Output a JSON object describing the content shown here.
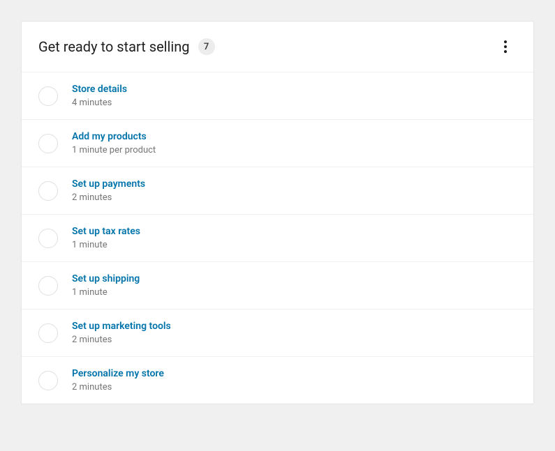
{
  "header": {
    "title": "Get ready to start selling",
    "badge_count": "7"
  },
  "tasks": [
    {
      "title": "Store details",
      "time": "4 minutes"
    },
    {
      "title": "Add my products",
      "time": "1 minute per product"
    },
    {
      "title": "Set up payments",
      "time": "2 minutes"
    },
    {
      "title": "Set up tax rates",
      "time": "1 minute"
    },
    {
      "title": "Set up shipping",
      "time": "1 minute"
    },
    {
      "title": "Set up marketing tools",
      "time": "2 minutes"
    },
    {
      "title": "Personalize my store",
      "time": "2 minutes"
    }
  ]
}
